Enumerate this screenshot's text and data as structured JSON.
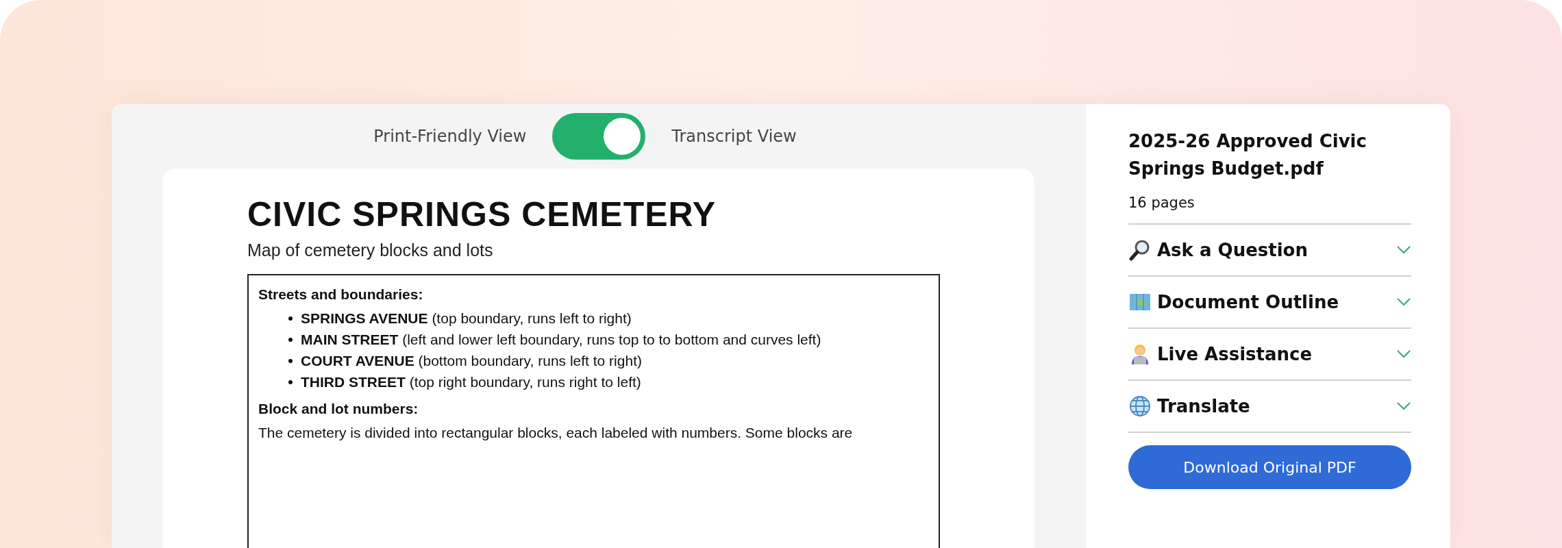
{
  "view_toggle": {
    "left_label": "Print-Friendly View",
    "right_label": "Transcript View",
    "on": true
  },
  "document": {
    "title": "CIVIC SPRINGS CEMETERY",
    "subtitle": "Map of cemetery blocks and lots",
    "sections": [
      {
        "heading": "Streets and boundaries:",
        "bullets": [
          "**SPRINGS AVENUE** (top boundary, runs left to right)",
          "**MAIN STREET** (left and lower left boundary, runs top  to  to bottom and curves left)",
          "**COURT AVENUE** (bottom boundary, runs left to right)",
          "**THIRD STREET** (top right boundary, runs right to left)"
        ]
      },
      {
        "heading": "Block and lot numbers:",
        "paragraph": "The cemetery is divided into rectangular blocks, each labeled with numbers. Some blocks are"
      }
    ]
  },
  "sidebar": {
    "file_name": "2025-26 Approved Civic Springs Budget.pdf",
    "page_count": "16 pages",
    "sections": [
      {
        "kind": "search",
        "label": "Ask a Question",
        "expanded": false
      },
      {
        "kind": "map",
        "label": "Document Outline",
        "expanded": false
      },
      {
        "kind": "assistant",
        "label": "Live Assistance",
        "expanded": false
      },
      {
        "kind": "globe",
        "label": "Translate",
        "expanded": false
      }
    ],
    "download_button": "Download Original PDF"
  }
}
